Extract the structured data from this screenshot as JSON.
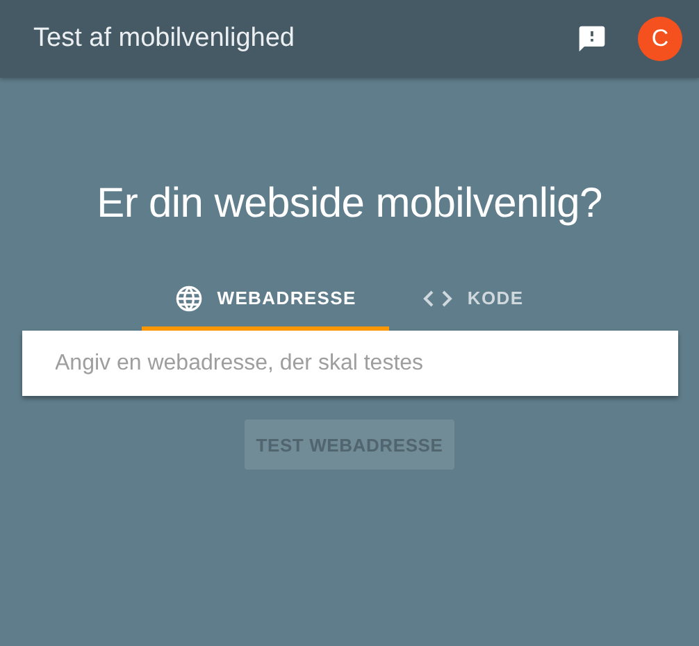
{
  "header": {
    "title": "Test af mobilvenlighed",
    "avatar": "C"
  },
  "heading": "Er din webside mobilvenlig?",
  "tabs": [
    {
      "label": "WEBADRESSE",
      "kind": "url",
      "selected": true
    },
    {
      "label": "KODE",
      "kind": "code",
      "selected": false
    }
  ],
  "search": {
    "placeholder": "Angiv en webadresse, der skal testes"
  },
  "submit": {
    "label": "TEST WEBADRESSE",
    "disabled": true
  }
}
